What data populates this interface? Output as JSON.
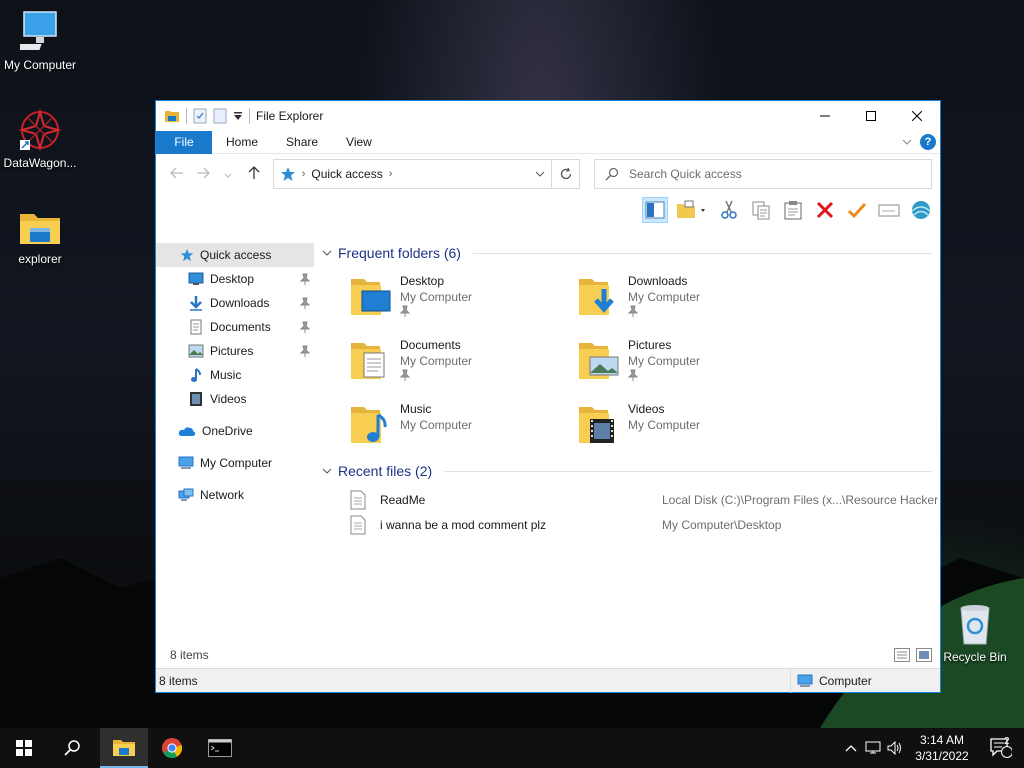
{
  "desktop": {
    "icons": [
      {
        "label": "My Computer",
        "icon": "monitor-icon"
      },
      {
        "label": "DataWagon...",
        "icon": "datawagon-icon"
      },
      {
        "label": "explorer",
        "icon": "folder-icon"
      },
      {
        "label": "Recycle Bin",
        "icon": "recycle-bin-icon"
      }
    ]
  },
  "window": {
    "title": "File Explorer",
    "ribbon_tabs": [
      "File",
      "Home",
      "Share",
      "View"
    ],
    "address": {
      "location": "Quick access"
    },
    "search": {
      "placeholder": "Search Quick access"
    },
    "toolbar": [
      "details-pane-icon",
      "new-folder-icon",
      "cut-icon",
      "copy-icon",
      "paste-icon",
      "delete-icon",
      "check-icon",
      "rename-icon",
      "network-shell-icon"
    ]
  },
  "sidebar": {
    "items": [
      {
        "label": "Quick access",
        "icon": "star-icon",
        "pinned": false,
        "selected": true
      },
      {
        "label": "Desktop",
        "icon": "desktop-icon",
        "pinned": true
      },
      {
        "label": "Downloads",
        "icon": "downloads-icon",
        "pinned": true
      },
      {
        "label": "Documents",
        "icon": "documents-icon",
        "pinned": true
      },
      {
        "label": "Pictures",
        "icon": "pictures-icon",
        "pinned": true
      },
      {
        "label": "Music",
        "icon": "music-icon",
        "pinned": false
      },
      {
        "label": "Videos",
        "icon": "videos-icon",
        "pinned": false
      },
      {
        "label": "OneDrive",
        "icon": "cloud-icon",
        "pinned": false
      },
      {
        "label": "My Computer",
        "icon": "computer-icon",
        "pinned": false
      },
      {
        "label": "Network",
        "icon": "network-icon",
        "pinned": false
      }
    ]
  },
  "frequent": {
    "header": "Frequent folders (6)",
    "folders": [
      {
        "name": "Desktop",
        "location": "My Computer",
        "pinned": true
      },
      {
        "name": "Downloads",
        "location": "My Computer",
        "pinned": true
      },
      {
        "name": "Documents",
        "location": "My Computer",
        "pinned": true
      },
      {
        "name": "Pictures",
        "location": "My Computer",
        "pinned": true
      },
      {
        "name": "Music",
        "location": "My Computer",
        "pinned": false
      },
      {
        "name": "Videos",
        "location": "My Computer",
        "pinned": false
      }
    ]
  },
  "recent": {
    "header": "Recent files (2)",
    "files": [
      {
        "name": "ReadMe",
        "path": "Local Disk (C:)\\Program Files (x...\\Resource Hacker"
      },
      {
        "name": "i wanna be a mod comment plz",
        "path": "My Computer\\Desktop"
      }
    ]
  },
  "status": {
    "inner_count": "8 items",
    "count": "8 items",
    "location": "Computer"
  },
  "taskbar": {
    "time": "3:14 AM",
    "date": "3/31/2022",
    "notifications": "2"
  },
  "colors": {
    "accent": "#1979ca",
    "header_blue": "#1e3287",
    "folder_yellow": "#f5c542"
  }
}
